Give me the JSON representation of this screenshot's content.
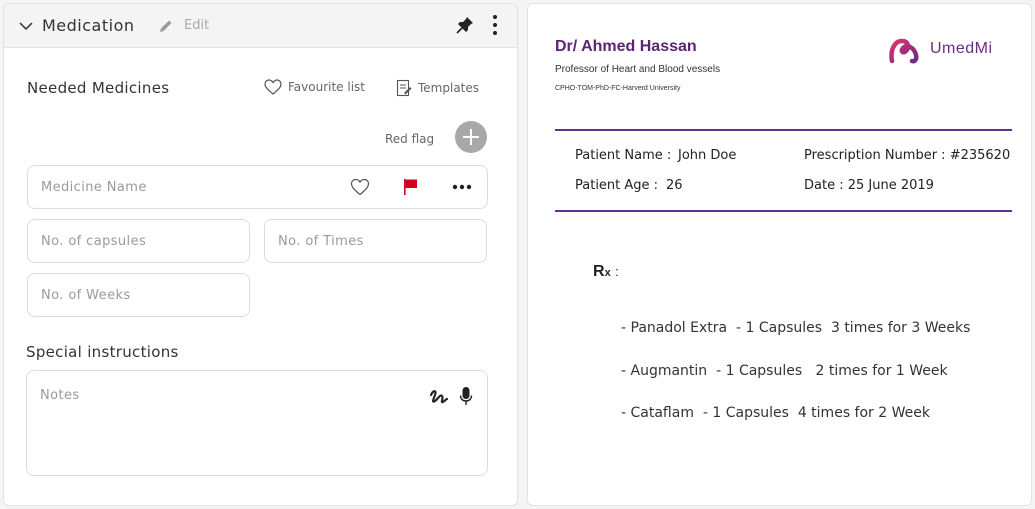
{
  "header": {
    "title": "Medication",
    "edit_label": "Edit"
  },
  "needed": {
    "title": "Needed Medicines",
    "favourite_label": "Favourite list",
    "templates_label": "Templates",
    "red_flag_label": "Red flag"
  },
  "fields": {
    "medicine_name": "Medicine Name",
    "capsules": "No. of capsules",
    "times": "No. of Times",
    "weeks": "No. of Weeks",
    "notes": "Notes"
  },
  "special": {
    "title": "Special instructions"
  },
  "prescription": {
    "doctor_name": "Dr/ Ahmed Hassan",
    "doctor_title": "Professor of Heart and Blood vessels",
    "doctor_credentials": "CPHO-TOM-PhD-FC-Harverd University",
    "logo_text": "UmedMi",
    "patient_name_label": "Patient Name :",
    "patient_name": "John Doe",
    "patient_age_label": "Patient Age :",
    "patient_age": "26",
    "prescription_number": "Prescription Number : #235620",
    "date": "Date : 25 June 2019",
    "rx_main": "R",
    "rx_sub": "x",
    "rx_colon": ":",
    "medicines": [
      "- Panadol Extra  - 1 Capsules  3 times for 3 Weeks",
      "- Augmantin  - 1 Capsules   2 times for 1 Week",
      "- Cataflam  - 1 Capsules  4 times for 2 Week"
    ]
  },
  "colors": {
    "brand_purple": "#6a2d86",
    "red_flag": "#d0021b",
    "add_button": "#a8a8a8"
  }
}
